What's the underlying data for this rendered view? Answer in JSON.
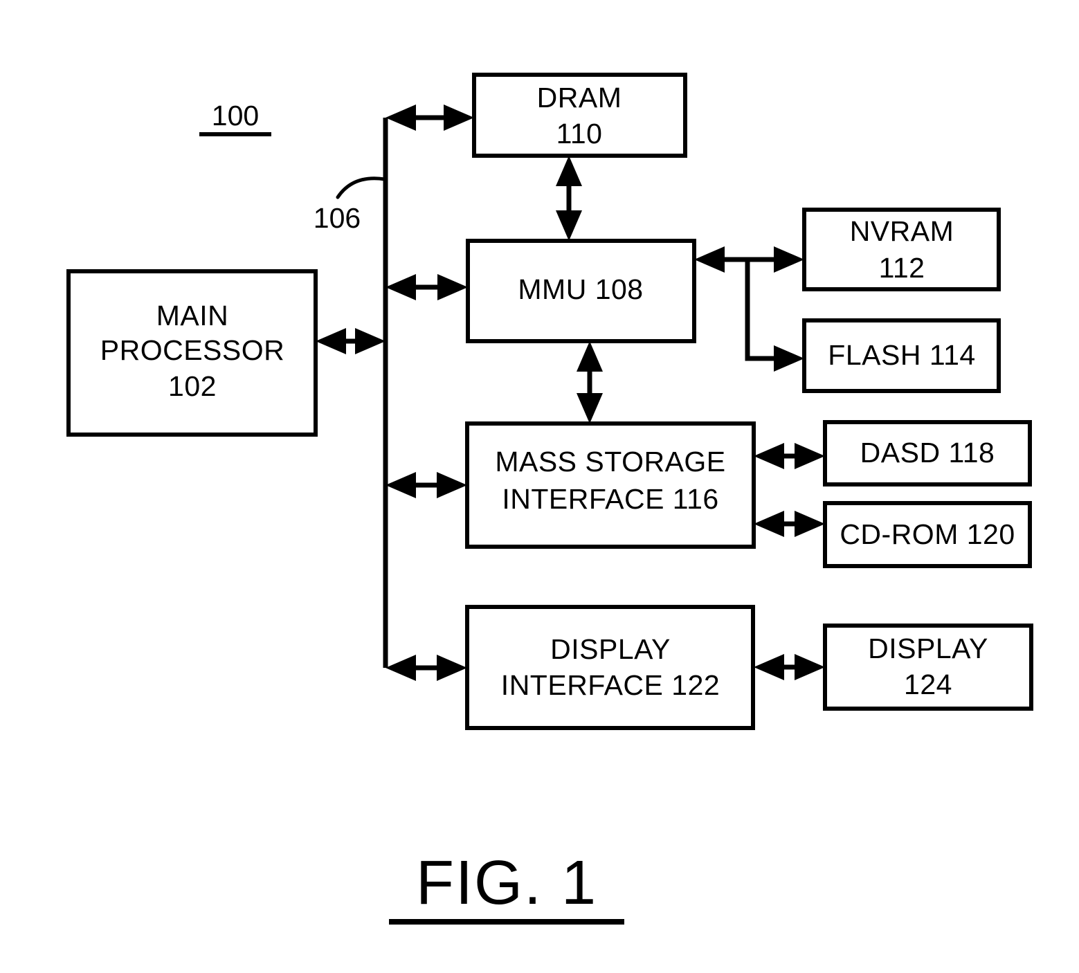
{
  "figure": {
    "caption": "FIG. 1",
    "system_ref": "100",
    "bus_ref": "106"
  },
  "boxes": {
    "main_processor": {
      "line1": "MAIN",
      "line2": "PROCESSOR",
      "line3": "102"
    },
    "dram": {
      "line1": "DRAM",
      "line2": "110"
    },
    "mmu": {
      "line1": "MMU 108"
    },
    "nvram": {
      "line1": "NVRAM",
      "line2": "112"
    },
    "flash": {
      "line1": "FLASH 114"
    },
    "mass_storage": {
      "line1": "MASS STORAGE",
      "line2": "INTERFACE 116"
    },
    "dasd": {
      "line1": "DASD 118"
    },
    "cdrom": {
      "line1": "CD-ROM 120"
    },
    "display_iface": {
      "line1": "DISPLAY",
      "line2": "INTERFACE 122"
    },
    "display": {
      "line1": "DISPLAY",
      "line2": "124"
    }
  },
  "connections": [
    {
      "name": "processor-to-bus",
      "from": "main_processor",
      "to": "system_bus",
      "style": "bidirectional"
    },
    {
      "name": "bus-to-dram",
      "from": "system_bus",
      "to": "dram",
      "style": "bidirectional"
    },
    {
      "name": "bus-to-mmu",
      "from": "system_bus",
      "to": "mmu",
      "style": "bidirectional"
    },
    {
      "name": "bus-to-mass-storage",
      "from": "system_bus",
      "to": "mass_storage",
      "style": "bidirectional"
    },
    {
      "name": "bus-to-display-interface",
      "from": "system_bus",
      "to": "display_iface",
      "style": "bidirectional"
    },
    {
      "name": "dram-to-mmu",
      "from": "dram",
      "to": "mmu",
      "style": "bidirectional"
    },
    {
      "name": "mmu-to-nvram",
      "from": "mmu",
      "to": "nvram",
      "style": "bidirectional"
    },
    {
      "name": "mmu-to-flash",
      "from": "mmu",
      "to": "flash",
      "style": "unidirectional"
    },
    {
      "name": "mmu-to-mass-storage",
      "from": "mmu",
      "to": "mass_storage",
      "style": "bidirectional"
    },
    {
      "name": "mass-storage-to-dasd",
      "from": "mass_storage",
      "to": "dasd",
      "style": "bidirectional"
    },
    {
      "name": "mass-storage-to-cdrom",
      "from": "mass_storage",
      "to": "cdrom",
      "style": "bidirectional"
    },
    {
      "name": "display-interface-to-display",
      "from": "display_iface",
      "to": "display",
      "style": "bidirectional"
    }
  ],
  "colors": {
    "stroke": "#000000",
    "background": "#ffffff",
    "text": "#000000"
  }
}
